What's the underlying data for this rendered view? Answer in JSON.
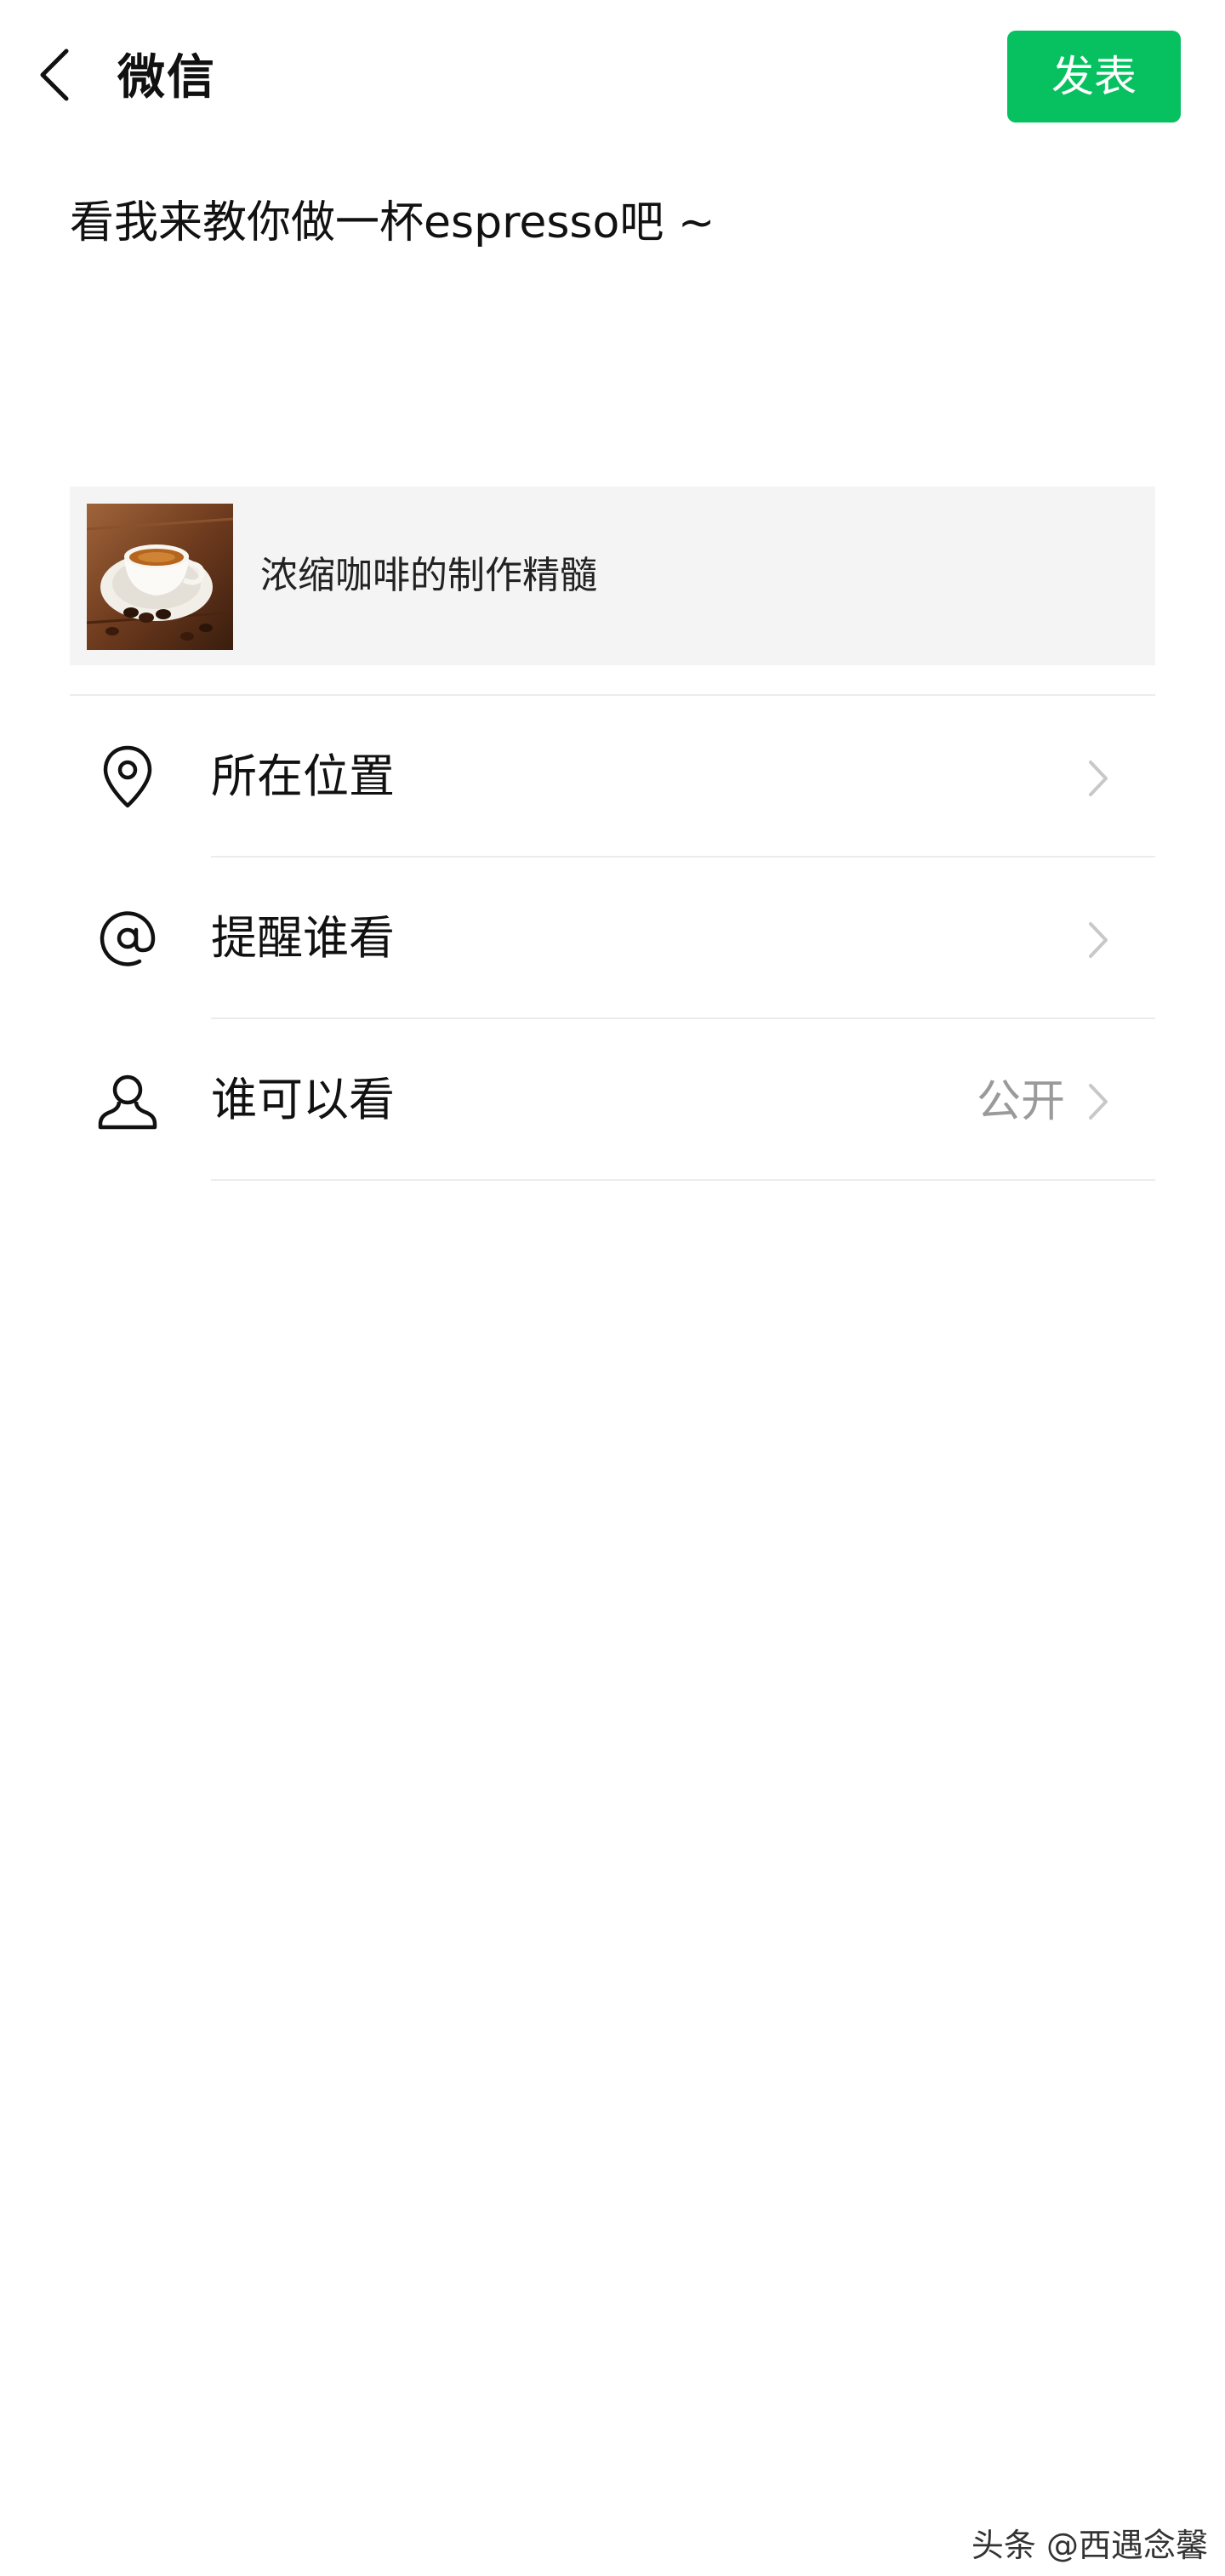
{
  "header": {
    "title": "微信",
    "back_icon": "chevron-left-icon",
    "publish_label": "发表",
    "publish_color": "#07c160"
  },
  "post": {
    "text": "看我来教你做一杯espresso吧 ~"
  },
  "link_card": {
    "title": "浓缩咖啡的制作精髓",
    "thumbnail": "espresso-cup-image"
  },
  "options": [
    {
      "icon": "location-pin-icon",
      "label": "所在位置",
      "value": ""
    },
    {
      "icon": "at-mention-icon",
      "label": "提醒谁看",
      "value": ""
    },
    {
      "icon": "person-icon",
      "label": "谁可以看",
      "value": "公开"
    }
  ],
  "watermark": "头条 @西遇念馨"
}
